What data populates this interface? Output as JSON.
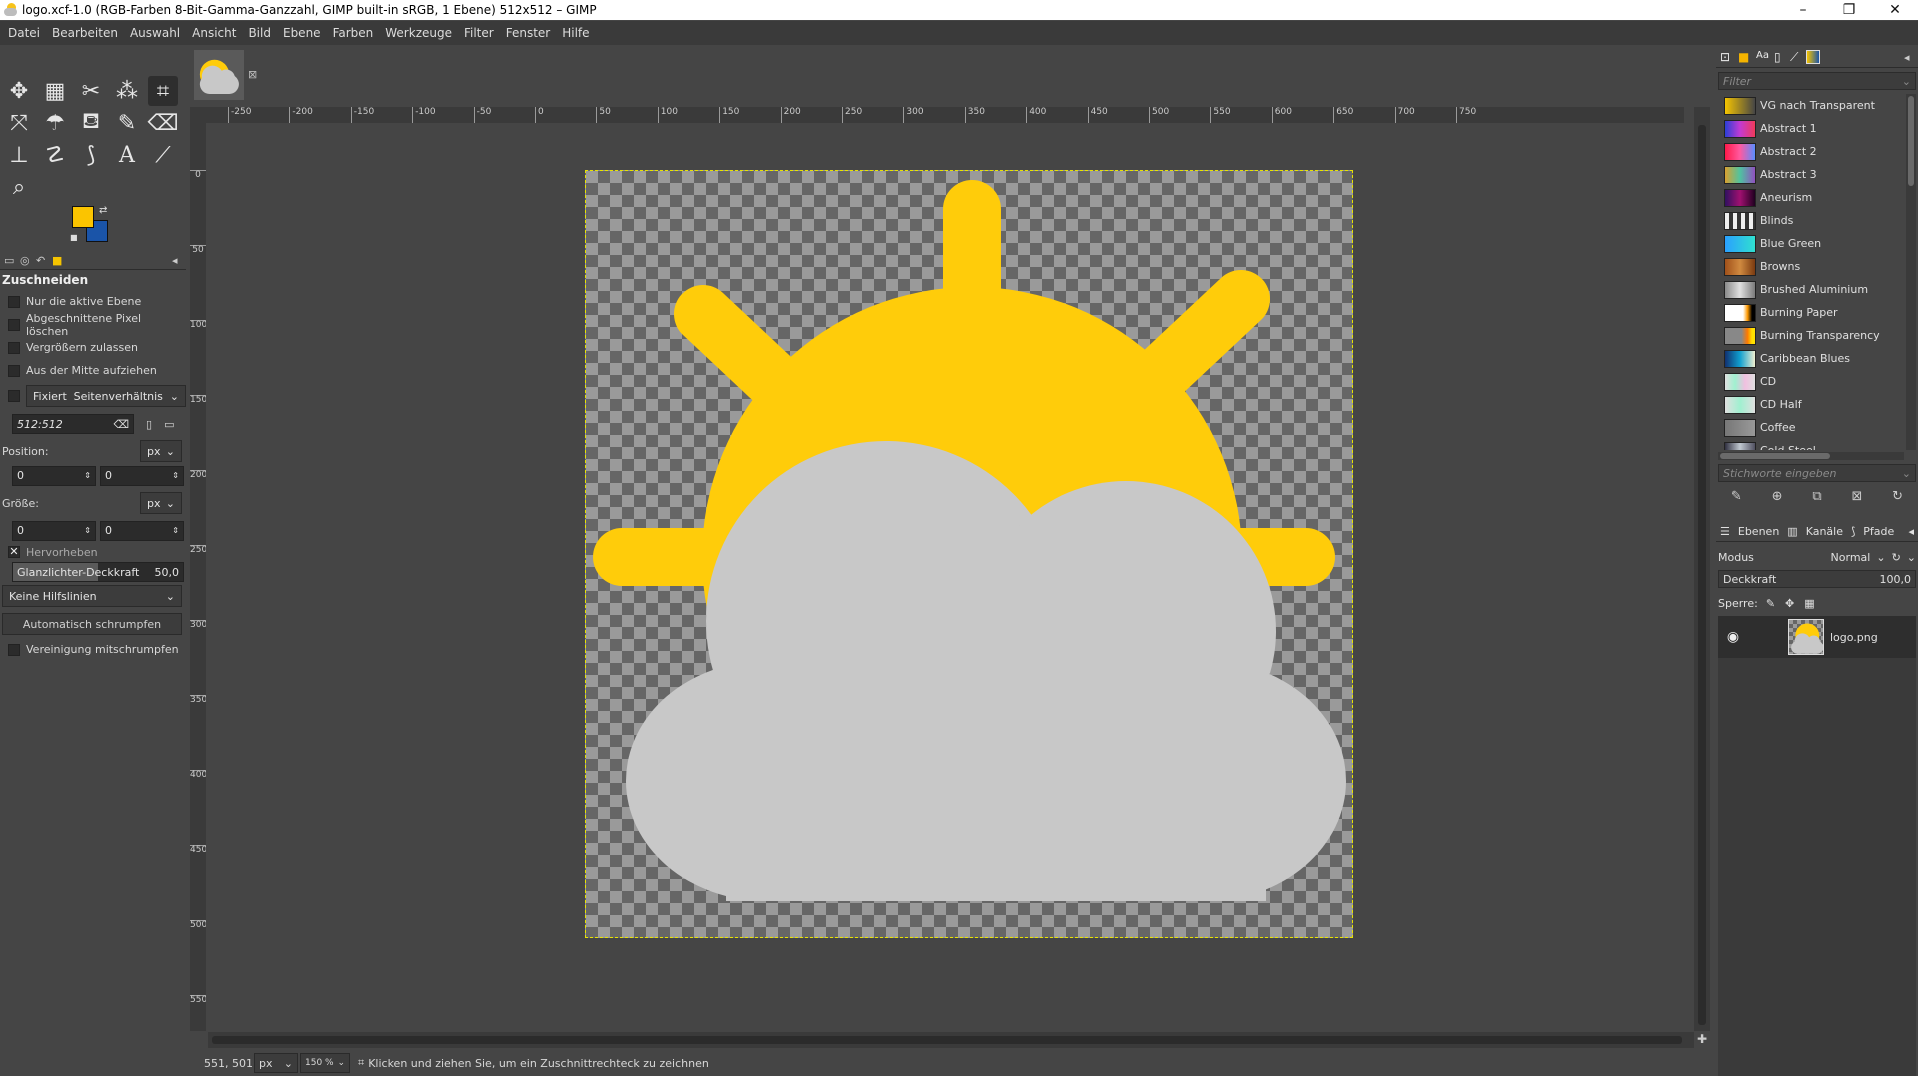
{
  "window": {
    "title": "logo.xcf-1.0 (RGB-Farben 8-Bit-Gamma-Ganzzahl, GIMP built-in sRGB, 1 Ebene) 512x512 – GIMP",
    "minimize": "–",
    "maximize": "❐",
    "close": "✕"
  },
  "menu": [
    "Datei",
    "Bearbeiten",
    "Auswahl",
    "Ansicht",
    "Bild",
    "Ebene",
    "Farben",
    "Werkzeuge",
    "Filter",
    "Fenster",
    "Hilfe"
  ],
  "colors": {
    "foreground": "#fbc400",
    "background": "#1a54a8",
    "sun": "#ffcc0a",
    "cloud": "#c8c8c8"
  },
  "tool_options": {
    "title": "Zuschneiden",
    "only_active_layer": "Nur die aktive Ebene",
    "delete_cropped": "Abgeschnittene Pixel löschen",
    "allow_growing": "Vergrößern zulassen",
    "expand_center": "Aus der Mitte aufziehen",
    "fixed_label": "Fixiert",
    "fixed_mode": "Seitenverhältnis",
    "ratio_value": "512:512",
    "position_label": "Position:",
    "position_unit": "px",
    "position_x": "0",
    "position_y": "0",
    "size_label": "Größe:",
    "size_unit": "px",
    "size_w": "0",
    "size_h": "0",
    "highlight_label": "Hervorheben",
    "highlight_opacity_label": "Glanzlichter-Deckkraft",
    "highlight_opacity_value": "50,0",
    "guides": "Keine Hilfslinien",
    "auto_shrink": "Automatisch schrumpfen",
    "shrink_merged": "Vereinigung mitschrumpfen"
  },
  "rulers": {
    "h_labels": [
      "-250",
      "-200",
      "-150",
      "-100",
      "-50",
      "0",
      "50",
      "100",
      "150",
      "200",
      "250",
      "300",
      "350",
      "400",
      "450",
      "500",
      "550",
      "600",
      "650",
      "700",
      "750"
    ],
    "v_labels": [
      "0",
      "50",
      "100",
      "150",
      "200",
      "250",
      "300",
      "350",
      "400",
      "450",
      "500",
      "550",
      "600"
    ]
  },
  "status": {
    "coords": "551, 501",
    "unit": "px",
    "zoom": "150 %",
    "message": "Klicken und ziehen Sie, um ein Zuschnittrechteck zu zeichnen"
  },
  "gradients": {
    "filter_placeholder": "Filter",
    "tags_placeholder": "Stichworte eingeben",
    "items": [
      {
        "name": "VG nach Transparent",
        "swatch": "linear-gradient(90deg,#f5c400,rgba(245,196,0,0))"
      },
      {
        "name": "Abstract 1",
        "swatch": "linear-gradient(90deg,#2a3fd6,#c23ad3,#f03a5a)"
      },
      {
        "name": "Abstract 2",
        "swatch": "linear-gradient(90deg,#ff1a4a,#ff5aa0,#5a8cff)"
      },
      {
        "name": "Abstract 3",
        "swatch": "linear-gradient(90deg,#d9a030,#4fc3a0,#9050c0)"
      },
      {
        "name": "Aneurism",
        "swatch": "linear-gradient(90deg,#301060,#a01070,#200020)"
      },
      {
        "name": "Blinds",
        "swatch": "repeating-linear-gradient(90deg,#eee 0 4px,#333 4px 8px)"
      },
      {
        "name": "Blue Green",
        "swatch": "linear-gradient(90deg,#2aa0ff,#30e0d0)"
      },
      {
        "name": "Browns",
        "swatch": "linear-gradient(90deg,#a0501a,#d08a40,#7a3a10)"
      },
      {
        "name": "Brushed Aluminium",
        "swatch": "linear-gradient(90deg,#8a8a8a,#e0e0e0,#7a7a7a)"
      },
      {
        "name": "Burning Paper",
        "swatch": "linear-gradient(90deg,#ffffff 60%,#ff9a00 75%,#000 90%)"
      },
      {
        "name": "Burning Transparency",
        "swatch": "linear-gradient(90deg,#888 55%,#ff7a00 75%,#ffe000 90%)"
      },
      {
        "name": "Caribbean Blues",
        "swatch": "linear-gradient(90deg,#103070,#10a0d0,#f0f0d0)"
      },
      {
        "name": "CD",
        "swatch": "linear-gradient(90deg,#e0e0e0,#a0f0d0,#f0c0e0,#e0e0e0)"
      },
      {
        "name": "CD Half",
        "swatch": "linear-gradient(90deg,#e0e0e0,#a0f0d0,#e0e0e0)"
      },
      {
        "name": "Coffee",
        "swatch": "linear-gradient(90deg,#777,#999)"
      },
      {
        "name": "Cold Steel",
        "swatch": "linear-gradient(90deg,#303040,#c0c8d0,#505060)"
      }
    ]
  },
  "layers_panel": {
    "tabs": [
      "Ebenen",
      "Kanäle",
      "Pfade"
    ],
    "mode_label": "Modus",
    "mode_value": "Normal",
    "opacity_label": "Deckkraft",
    "opacity_value": "100,0",
    "lock_label": "Sperre:",
    "layers": [
      {
        "name": "logo.png"
      }
    ]
  }
}
